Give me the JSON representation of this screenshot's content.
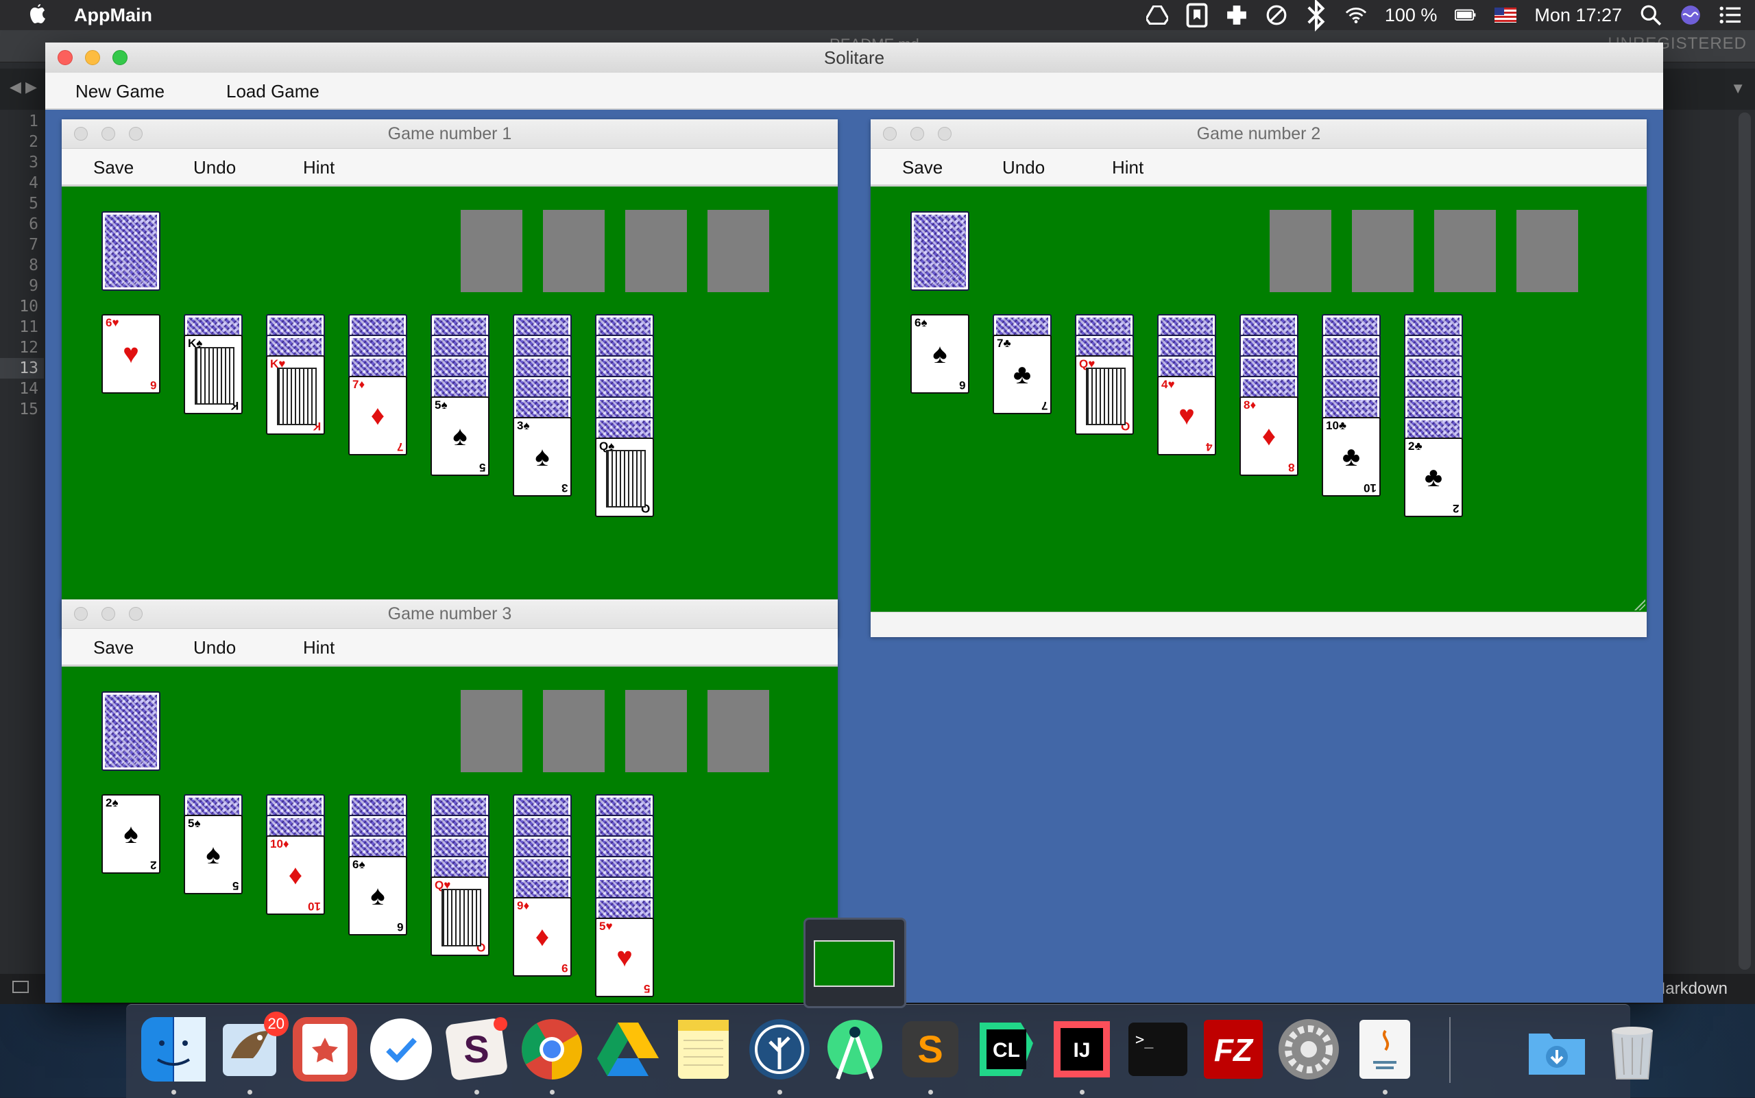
{
  "menubar": {
    "app_name": "AppMain",
    "battery": "100 %",
    "clock": "Mon 17:27",
    "icons": [
      "apple-icon",
      "google-drive-icon",
      "bookmark-icon",
      "plus-cross-icon",
      "do-not-disturb-icon",
      "bluetooth-icon",
      "wifi-icon",
      "battery-icon",
      "us-flag-icon",
      "search-icon",
      "siri-icon",
      "menu-list-icon"
    ]
  },
  "editor": {
    "tab_title": "README.md",
    "unregistered": "UNREGISTERED",
    "line_numbers": [
      "1",
      "2",
      "3",
      "4",
      "5",
      "6",
      "7",
      "8",
      "9",
      "10",
      "11",
      "12",
      "13",
      "14",
      "15"
    ],
    "active_line": "13",
    "syntax_mode": "Markdown"
  },
  "solitaire": {
    "title": "Solitare",
    "menu": {
      "new_game": "New Game",
      "load_game": "Load Game"
    },
    "games": [
      {
        "title": "Game number 1",
        "menu": {
          "save": "Save",
          "undo": "Undo",
          "hint": "Hint"
        },
        "tableau": [
          {
            "hidden": 0,
            "visible": [
              "6♥"
            ]
          },
          {
            "hidden": 1,
            "visible": [
              "K♠"
            ]
          },
          {
            "hidden": 2,
            "visible": [
              "K♥"
            ]
          },
          {
            "hidden": 3,
            "visible": [
              "7♦"
            ]
          },
          {
            "hidden": 4,
            "visible": [
              "5♠"
            ]
          },
          {
            "hidden": 5,
            "visible": [
              "3♠"
            ]
          },
          {
            "hidden": 6,
            "visible": [
              "Q♠"
            ]
          }
        ]
      },
      {
        "title": "Game number 2",
        "menu": {
          "save": "Save",
          "undo": "Undo",
          "hint": "Hint"
        },
        "tableau": [
          {
            "hidden": 0,
            "visible": [
              "6♠"
            ]
          },
          {
            "hidden": 1,
            "visible": [
              "7♣"
            ]
          },
          {
            "hidden": 2,
            "visible": [
              "Q♥"
            ]
          },
          {
            "hidden": 3,
            "visible": [
              "4♥"
            ]
          },
          {
            "hidden": 4,
            "visible": [
              "8♦"
            ]
          },
          {
            "hidden": 5,
            "visible": [
              "10♣"
            ]
          },
          {
            "hidden": 6,
            "visible": [
              "2♣"
            ]
          }
        ]
      },
      {
        "title": "Game number 3",
        "menu": {
          "save": "Save",
          "undo": "Undo",
          "hint": "Hint"
        },
        "tableau": [
          {
            "hidden": 0,
            "visible": [
              "2♠"
            ]
          },
          {
            "hidden": 1,
            "visible": [
              "5♠"
            ]
          },
          {
            "hidden": 2,
            "visible": [
              "10♦"
            ]
          },
          {
            "hidden": 3,
            "visible": [
              "6♠"
            ]
          },
          {
            "hidden": 4,
            "visible": [
              "Q♥"
            ]
          },
          {
            "hidden": 5,
            "visible": [
              "9♦"
            ]
          },
          {
            "hidden": 6,
            "visible": [
              "5♥"
            ]
          }
        ]
      }
    ]
  },
  "dock": {
    "apps": [
      {
        "name": "Finder",
        "icon": "finder-icon",
        "running": true
      },
      {
        "name": "Mail",
        "icon": "mail-icon",
        "running": true,
        "badge": "20"
      },
      {
        "name": "Wunderlist",
        "icon": "wunderlist-icon",
        "running": false
      },
      {
        "name": "Things",
        "icon": "checkmark-icon",
        "running": false
      },
      {
        "name": "Slack",
        "icon": "slack-icon",
        "running": true,
        "badge_dot": true
      },
      {
        "name": "Chrome",
        "icon": "chrome-icon",
        "running": true
      },
      {
        "name": "Google Drive",
        "icon": "drive-icon",
        "running": false
      },
      {
        "name": "Notes",
        "icon": "notes-icon",
        "running": false
      },
      {
        "name": "SourceTree",
        "icon": "sourcetree-icon",
        "running": true
      },
      {
        "name": "Android Studio",
        "icon": "android-studio-icon",
        "running": false
      },
      {
        "name": "Sublime Text",
        "icon": "sublime-icon",
        "running": true
      },
      {
        "name": "CLion",
        "icon": "clion-icon",
        "running": false
      },
      {
        "name": "IntelliJ IDEA",
        "icon": "intellij-icon",
        "running": true
      },
      {
        "name": "Terminal",
        "icon": "terminal-icon",
        "running": false
      },
      {
        "name": "FileZilla",
        "icon": "filezilla-icon",
        "running": false
      },
      {
        "name": "System Preferences",
        "icon": "gear-icon",
        "running": false
      },
      {
        "name": "Java",
        "icon": "java-icon",
        "running": true
      },
      {
        "name": "Downloads",
        "icon": "downloads-folder-icon",
        "running": false
      },
      {
        "name": "Trash",
        "icon": "trash-icon",
        "running": false
      }
    ],
    "labels": {
      "cl": "CL",
      "ij": "IJ",
      "terminal": ">_",
      "filezilla": "FZ",
      "slack": "S",
      "sublime": "S"
    }
  }
}
